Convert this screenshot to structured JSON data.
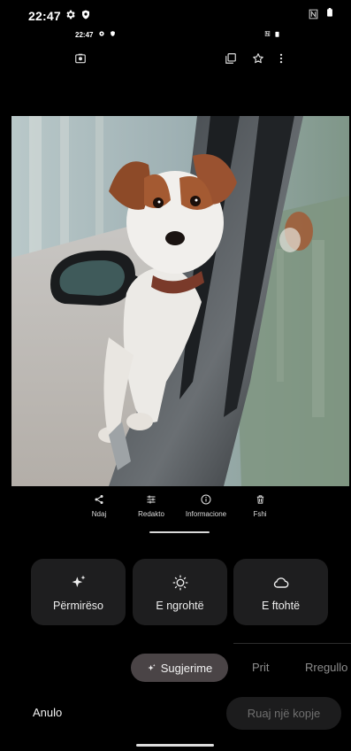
{
  "status_bar": {
    "time": "22:47"
  },
  "mini_status_bar": {
    "time": "22:47"
  },
  "actions": {
    "share": "Ndaj",
    "edit": "Redakto",
    "info": "Informacione",
    "delete": "Fshi"
  },
  "suggestions": {
    "enhance": "Përmirëso",
    "warm": "E ngrohtë",
    "cool": "E ftohtë"
  },
  "tabs": {
    "active": "Sugjerime",
    "crop": "Prit",
    "adjust": "Rregullo"
  },
  "bottom": {
    "cancel": "Anulo",
    "save_copy": "Ruaj një kopje"
  },
  "colors": {
    "background": "#000000",
    "card": "#1e1e1f",
    "active_tab": "#4a4446"
  },
  "icons": [
    "sparkle-icon",
    "sun-icon",
    "cloud-icon",
    "share-icon",
    "sliders-icon",
    "info-icon",
    "trash-icon",
    "star-icon",
    "more-icon"
  ]
}
